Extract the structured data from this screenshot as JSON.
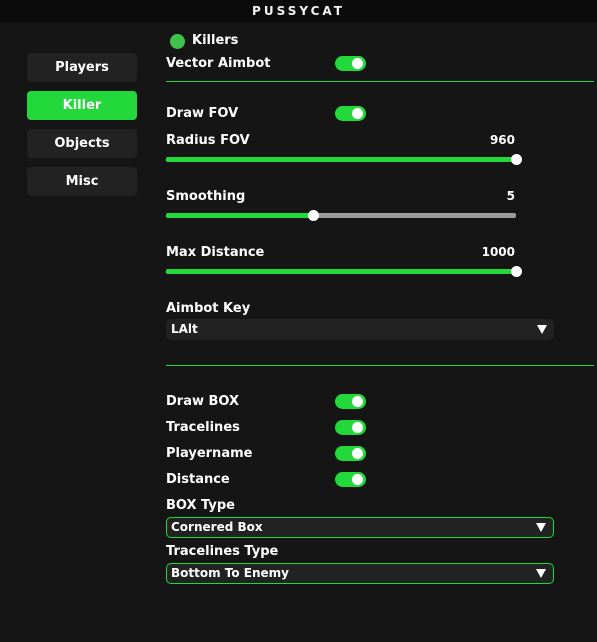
{
  "window": {
    "title": "PUSSYCAT"
  },
  "nav": {
    "items": [
      {
        "label": "Players",
        "active": false
      },
      {
        "label": "Killer",
        "active": true
      },
      {
        "label": "Objects",
        "active": false
      },
      {
        "label": "Misc",
        "active": false
      }
    ]
  },
  "section": {
    "title": "Killers",
    "status_color": "#3fc24a"
  },
  "aimbot": {
    "vector_aimbot": {
      "label": "Vector Aimbot",
      "enabled": true
    },
    "draw_fov": {
      "label": "Draw FOV",
      "enabled": true
    },
    "radius_fov": {
      "label": "Radius FOV",
      "value": "960",
      "fraction": 1.0
    },
    "smoothing": {
      "label": "Smoothing",
      "value": "5",
      "fraction": 0.42
    },
    "max_distance": {
      "label": "Max Distance",
      "value": "1000",
      "fraction": 1.0
    },
    "aimbot_key": {
      "label": "Aimbot Key",
      "selected": "LAlt"
    }
  },
  "esp": {
    "draw_box": {
      "label": "Draw BOX",
      "enabled": true
    },
    "tracelines": {
      "label": "Tracelines",
      "enabled": true
    },
    "playername": {
      "label": "Playername",
      "enabled": true
    },
    "distance": {
      "label": "Distance",
      "enabled": true
    },
    "box_type": {
      "label": "BOX Type",
      "selected": "Cornered Box"
    },
    "tracelines_type": {
      "label": "Tracelines Type",
      "selected": "Bottom To Enemy"
    }
  },
  "colors": {
    "accent": "#22d83a",
    "background": "#151515",
    "control": "#222222"
  }
}
